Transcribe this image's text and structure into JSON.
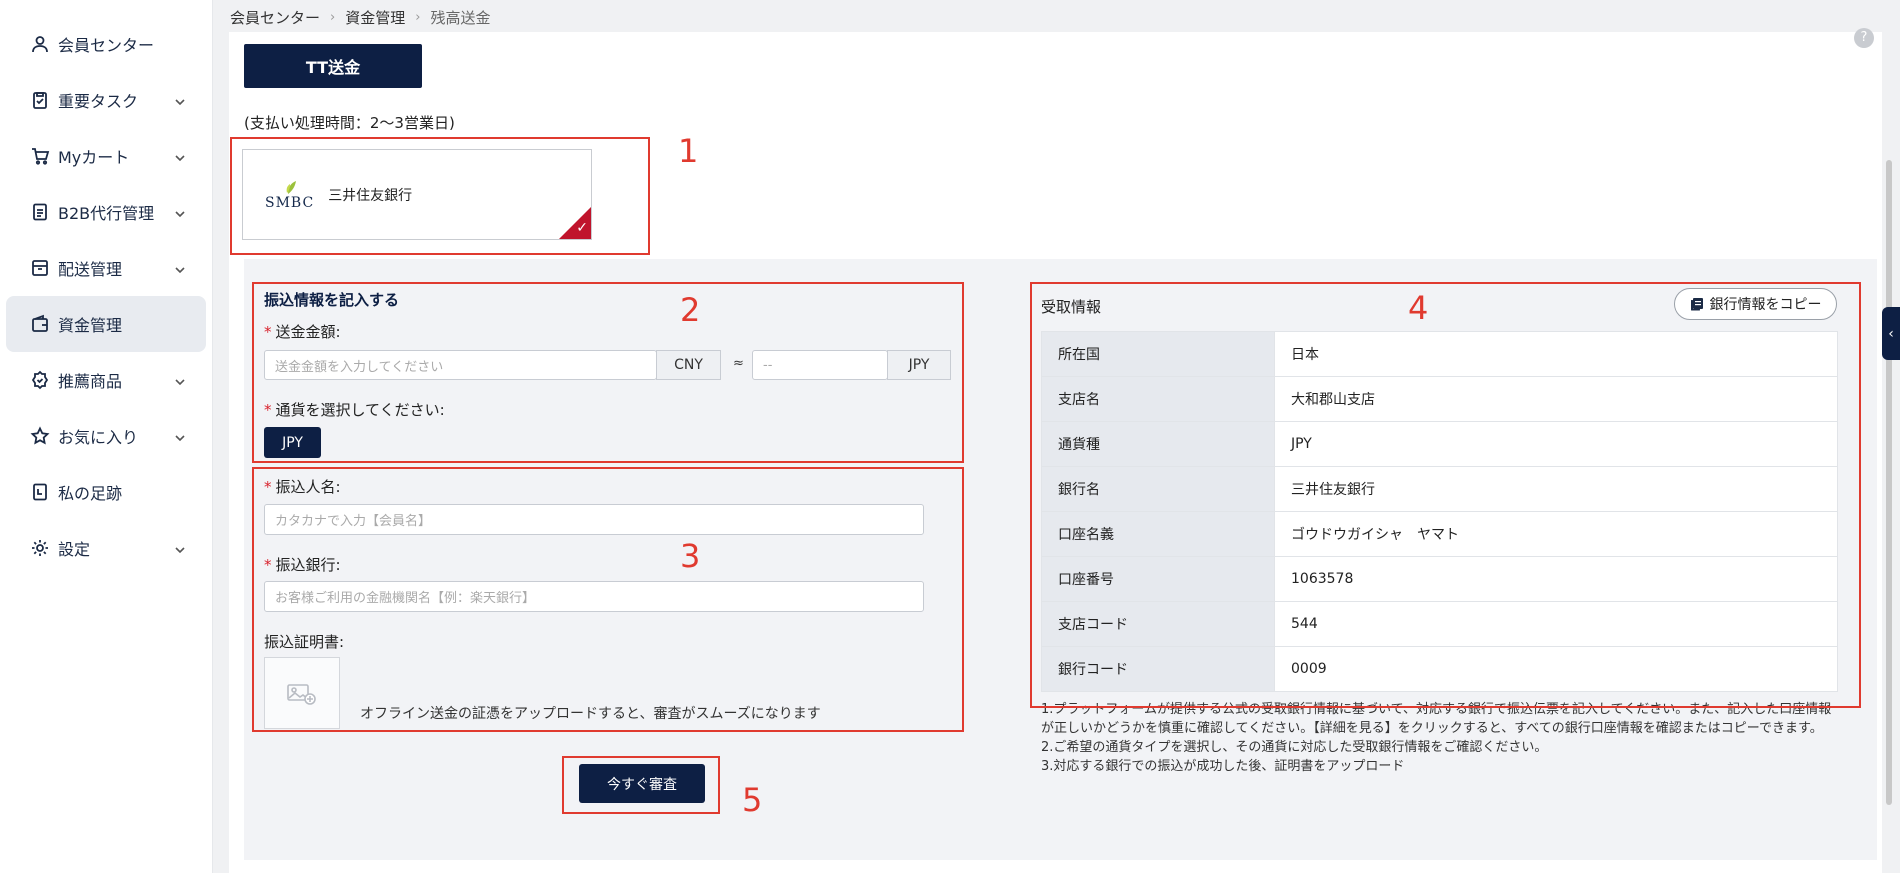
{
  "sidebar": {
    "items": [
      {
        "label": "会員センター",
        "icon": "user-icon",
        "chevron": false
      },
      {
        "label": "重要タスク",
        "icon": "clipboard-check-icon",
        "chevron": true
      },
      {
        "label": "Myカート",
        "icon": "cart-icon",
        "chevron": true
      },
      {
        "label": "B2B代行管理",
        "icon": "document-icon",
        "chevron": true
      },
      {
        "label": "配送管理",
        "icon": "box-icon",
        "chevron": true
      },
      {
        "label": "資金管理",
        "icon": "wallet-icon",
        "chevron": false,
        "active": true
      },
      {
        "label": "推薦商品",
        "icon": "badge-icon",
        "chevron": true
      },
      {
        "label": "お気に入り",
        "icon": "star-icon",
        "chevron": true
      },
      {
        "label": "私の足跡",
        "icon": "history-icon",
        "chevron": false
      },
      {
        "label": "設定",
        "icon": "gear-icon",
        "chevron": true
      }
    ]
  },
  "breadcrumb": {
    "items": [
      "会員センター",
      "資金管理",
      "残高送金"
    ],
    "separator": "›"
  },
  "tab": {
    "label": "TT送金"
  },
  "processing_time": "(支払い処理時間：2〜3営業日)",
  "bank": {
    "logo_text": "SMBC",
    "name": "三井住友銀行"
  },
  "annotations": [
    "1",
    "2",
    "3",
    "4",
    "5"
  ],
  "form": {
    "section_title": "振込情報を記入する",
    "amount_label": "送金金額:",
    "amount_placeholder": "送金金額を入力してください",
    "amount_currency": "CNY",
    "approx_symbol": "≈",
    "converted_placeholder": "--",
    "converted_currency": "JPY",
    "currency_label": "通貨を選択してください:",
    "currency_option": "JPY",
    "payer_label": "振込人名:",
    "payer_placeholder": "カタカナで入力【会員名】",
    "payer_bank_label": "振込銀行:",
    "payer_bank_placeholder": "お客様ご利用の金融機関名【例：楽天銀行】",
    "proof_label": "振込証明書:",
    "upload_hint": "オフライン送金の証憑をアップロードすると、審査がスムーズになります",
    "required_mark": "*",
    "submit_label": "今すぐ審査"
  },
  "receiver": {
    "title": "受取情報",
    "copy_label": "銀行情報をコピー",
    "rows": [
      {
        "key": "所在国",
        "value": "日本"
      },
      {
        "key": "支店名",
        "value": "大和郡山支店"
      },
      {
        "key": "通貨種",
        "value": "JPY"
      },
      {
        "key": "銀行名",
        "value": "三井住友銀行"
      },
      {
        "key": "口座名義",
        "value": "ゴウドウガイシャ　ヤマト"
      },
      {
        "key": "口座番号",
        "value": "1063578"
      },
      {
        "key": "支店コード",
        "value": "544"
      },
      {
        "key": "銀行コード",
        "value": "0009"
      }
    ]
  },
  "notes": [
    "1.プラットフォームが提供する公式の受取銀行情報に基づいて、対応する銀行で振込伝票を記入してください。また、記入した口座情報が正しいかどうかを慎重に確認してください。【詳細を見る】をクリックすると、すべての銀行口座情報を確認またはコピーできます。",
    "2.ご希望の通貨タイプを選択し、その通貨に対応した受取銀行情報をご確認ください。",
    "3.対応する銀行での振込が成功した後、証明書をアップロード"
  ],
  "colors": {
    "primary": "#0d1f44",
    "annotation": "#e03a2f",
    "required": "#d9232e",
    "check": "#c0142c"
  }
}
